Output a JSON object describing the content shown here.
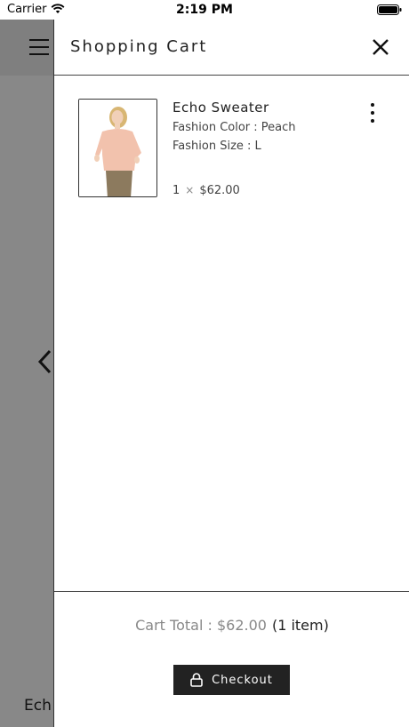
{
  "status_bar": {
    "carrier": "Carrier",
    "time": "2:19 PM",
    "wifi_icon": "wifi-icon",
    "battery_icon": "battery-icon"
  },
  "underlay": {
    "partial_text": "Ech",
    "menu_icon": "hamburger-menu-icon",
    "back_icon": "chevron-left-icon"
  },
  "drawer": {
    "title": "Shopping Cart",
    "close_icon": "close-icon"
  },
  "cart_items": [
    {
      "name": "Echo Sweater",
      "color_line": "Fashion Color : Peach",
      "size_line": "Fashion Size : L",
      "quantity": "1",
      "times": "×",
      "price": "$62.00"
    }
  ],
  "footer": {
    "total_label": "Cart Total : $62.00",
    "total_count": "(1 item)",
    "checkout_label": "Checkout"
  },
  "colors": {
    "checkout_bg": "#222222",
    "overlay": "#888888",
    "accent_text": "#222222"
  }
}
